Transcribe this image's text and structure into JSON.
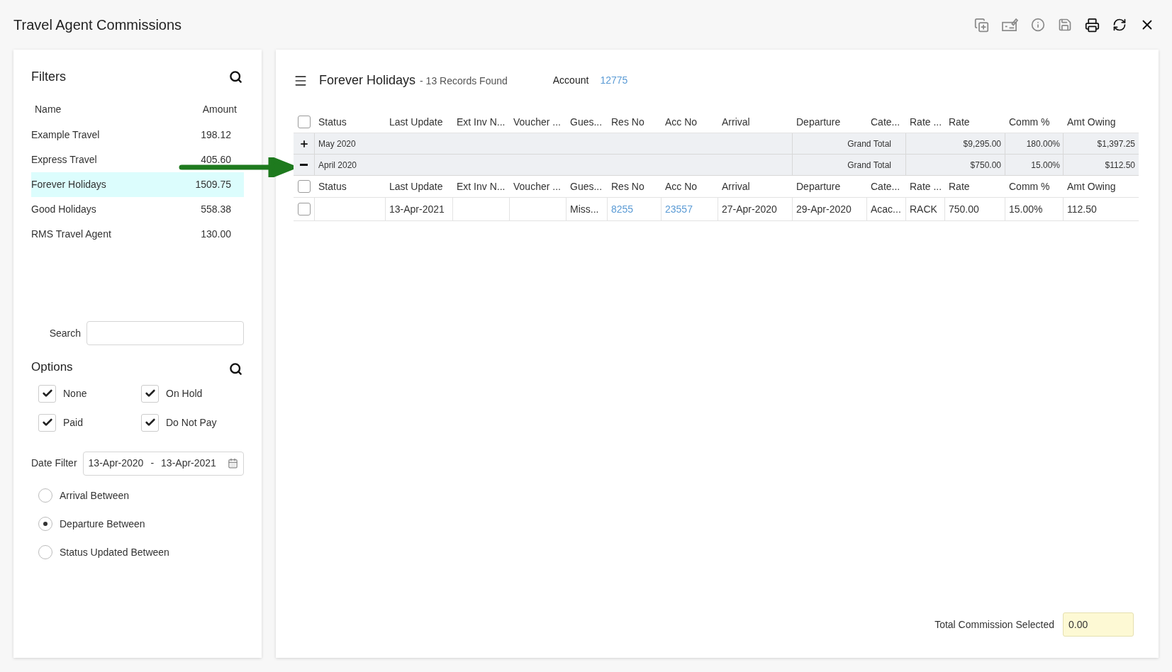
{
  "window": {
    "title": "Travel Agent Commissions"
  },
  "filters": {
    "title": "Filters",
    "columns": [
      "Name",
      "Amount"
    ],
    "agents": [
      {
        "name": "Example Travel",
        "amount": "198.12",
        "selected": false
      },
      {
        "name": "Express Travel",
        "amount": "405.60",
        "selected": false
      },
      {
        "name": "Forever Holidays",
        "amount": "1509.75",
        "selected": true
      },
      {
        "name": "Good Holidays",
        "amount": "558.38",
        "selected": false
      },
      {
        "name": "RMS Travel Agent",
        "amount": "130.00",
        "selected": false
      }
    ],
    "search": {
      "label": "Search"
    },
    "options": {
      "title": "Options",
      "items": [
        {
          "label": "None",
          "checked": true
        },
        {
          "label": "On Hold",
          "checked": true
        },
        {
          "label": "Paid",
          "checked": true
        },
        {
          "label": "Do Not Pay",
          "checked": true
        }
      ]
    },
    "date_filter": {
      "label": "Date Filter",
      "from": "13-Apr-2020",
      "separator": "-",
      "to": "13-Apr-2021"
    },
    "date_modes": [
      {
        "label": "Arrival Between",
        "selected": false
      },
      {
        "label": "Departure Between",
        "selected": true
      },
      {
        "label": "Status Updated Between",
        "selected": false
      }
    ]
  },
  "main": {
    "agent": "Forever Holidays",
    "records": "- 13 Records Found",
    "account_label": "Account",
    "account": "12775",
    "header": {
      "checked": false,
      "columns": [
        "Status",
        "Last Update",
        "Ext Inv N...",
        "Voucher ...",
        "Gues...",
        "Res No",
        "Acc No",
        "Arrival",
        "Departure",
        "Cate...",
        "Rate ...",
        "Rate",
        "Comm %",
        "Amt Owing"
      ]
    },
    "groups": [
      {
        "label": "May 2020",
        "expanded": false,
        "total_label": "Grand Total",
        "rate_total": "$9,295.00",
        "comm_total": "180.00%",
        "amt_total": "$1,397.25"
      },
      {
        "label": "April 2020",
        "expanded": true,
        "total_label": "Grand Total",
        "rate_total": "$750.00",
        "comm_total": "15.00%",
        "amt_total": "$112.50",
        "header": {
          "checked": false,
          "columns": [
            "Status",
            "Last Update",
            "Ext Inv N...",
            "Voucher ...",
            "Gues...",
            "Res No",
            "Acc No",
            "Arrival",
            "Departure",
            "Cate...",
            "Rate ...",
            "Rate",
            "Comm %",
            "Amt Owing"
          ]
        },
        "rows": [
          {
            "checked": false,
            "cells": [
              null,
              {
                "text": "13-Apr-2021",
                "link": false
              },
              null,
              null,
              {
                "text": "Miss...",
                "link": false
              },
              {
                "text": "8255",
                "link": true
              },
              {
                "text": "23557",
                "link": true
              },
              {
                "text": "27-Apr-2020",
                "link": false
              },
              {
                "text": "29-Apr-2020",
                "link": false
              },
              {
                "text": "Acac...",
                "link": false
              },
              {
                "text": "RACK",
                "link": false
              },
              {
                "text": "750.00",
                "link": false
              },
              {
                "text": "15.00%",
                "link": false
              },
              {
                "text": "112.50",
                "link": false
              }
            ]
          }
        ]
      }
    ],
    "total": {
      "label": "Total Commission Selected",
      "value": "0.00"
    }
  }
}
